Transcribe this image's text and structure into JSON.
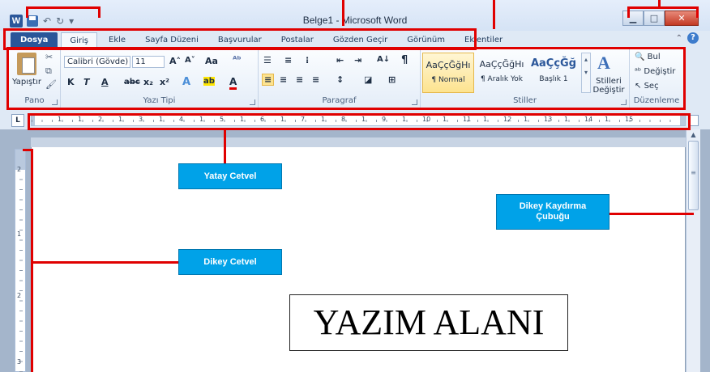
{
  "window": {
    "app_icon": "W",
    "title": "Belge1  -  Microsoft Word",
    "min_label": "▁",
    "max_label": "□",
    "close_label": "✕"
  },
  "qat": {
    "undo": "↶",
    "redo": "↻",
    "customize": "▾"
  },
  "tabs": [
    {
      "label": "Dosya"
    },
    {
      "label": "Giriş"
    },
    {
      "label": "Ekle"
    },
    {
      "label": "Sayfa Düzeni"
    },
    {
      "label": "Başvurular"
    },
    {
      "label": "Postalar"
    },
    {
      "label": "Gözden Geçir"
    },
    {
      "label": "Görünüm"
    },
    {
      "label": "Eklentiler"
    }
  ],
  "help": {
    "collapse": "⌃",
    "help": "?"
  },
  "groups": {
    "clipboard": {
      "label": "Pano",
      "paste": "Yapıştır",
      "cut": "✂",
      "copy": "⧉",
      "painter": "🖌"
    },
    "font": {
      "label": "Yazı Tipi",
      "font_name": "Calibri (Gövde)",
      "font_size": "11",
      "grow": "A˄",
      "shrink": "A˅",
      "case": "Aa",
      "clear": "ᴬᵇ",
      "bold": "K",
      "italic": "T",
      "underline": "A",
      "strike": "abc",
      "subscript": "x₂",
      "superscript": "x²",
      "effects": "A",
      "highlight": "ab",
      "color": "A"
    },
    "paragraph": {
      "label": "Paragraf",
      "bullets": "☰",
      "numbering": "≡",
      "multilevel": "⁝",
      "dec_indent": "⇤",
      "inc_indent": "⇥",
      "sort": "A↓",
      "pilcrow": "¶",
      "left": "≡",
      "center": "≡",
      "right": "≡",
      "justify": "≡",
      "spacing": "↕",
      "shading": "◪",
      "border": "⊞"
    },
    "styles": {
      "label": "Stiller",
      "items": [
        {
          "sample": "AaÇçĞğHı",
          "name": "¶ Normal"
        },
        {
          "sample": "AaÇçĞğHı",
          "name": "¶ Aralık Yok"
        },
        {
          "sample": "AaÇçĞğ",
          "name": "Başlık 1"
        }
      ],
      "change_styles": "Stilleri Değiştir"
    },
    "editing": {
      "label": "Düzenleme",
      "find": "Bul",
      "replace": "Değiştir",
      "select": "Seç"
    }
  },
  "ruler": {
    "corner": "L",
    "h_numbers": [
      "1",
      "1",
      "2",
      "1",
      "3",
      "1",
      "4",
      "1",
      "5",
      "1",
      "6",
      "1",
      "7",
      "1",
      "8",
      "1",
      "9",
      "1",
      "10",
      "1",
      "11",
      "1",
      "12",
      "1",
      "13",
      "1",
      "14",
      "1",
      "15"
    ],
    "v_numbers": [
      "2",
      "1",
      "2",
      "3"
    ]
  },
  "document": {
    "writing_area": "YAZIM ALANI"
  },
  "callouts": {
    "horizontal_ruler": "Yatay Cetvel",
    "vertical_scrollbar": "Dikey Kaydırma Çubuğu",
    "vertical_ruler": "Dikey Cetvel"
  },
  "colors": {
    "accent_red": "#e00000",
    "callout_blue": "#00a2e8",
    "file_tab": "#2a5699"
  }
}
